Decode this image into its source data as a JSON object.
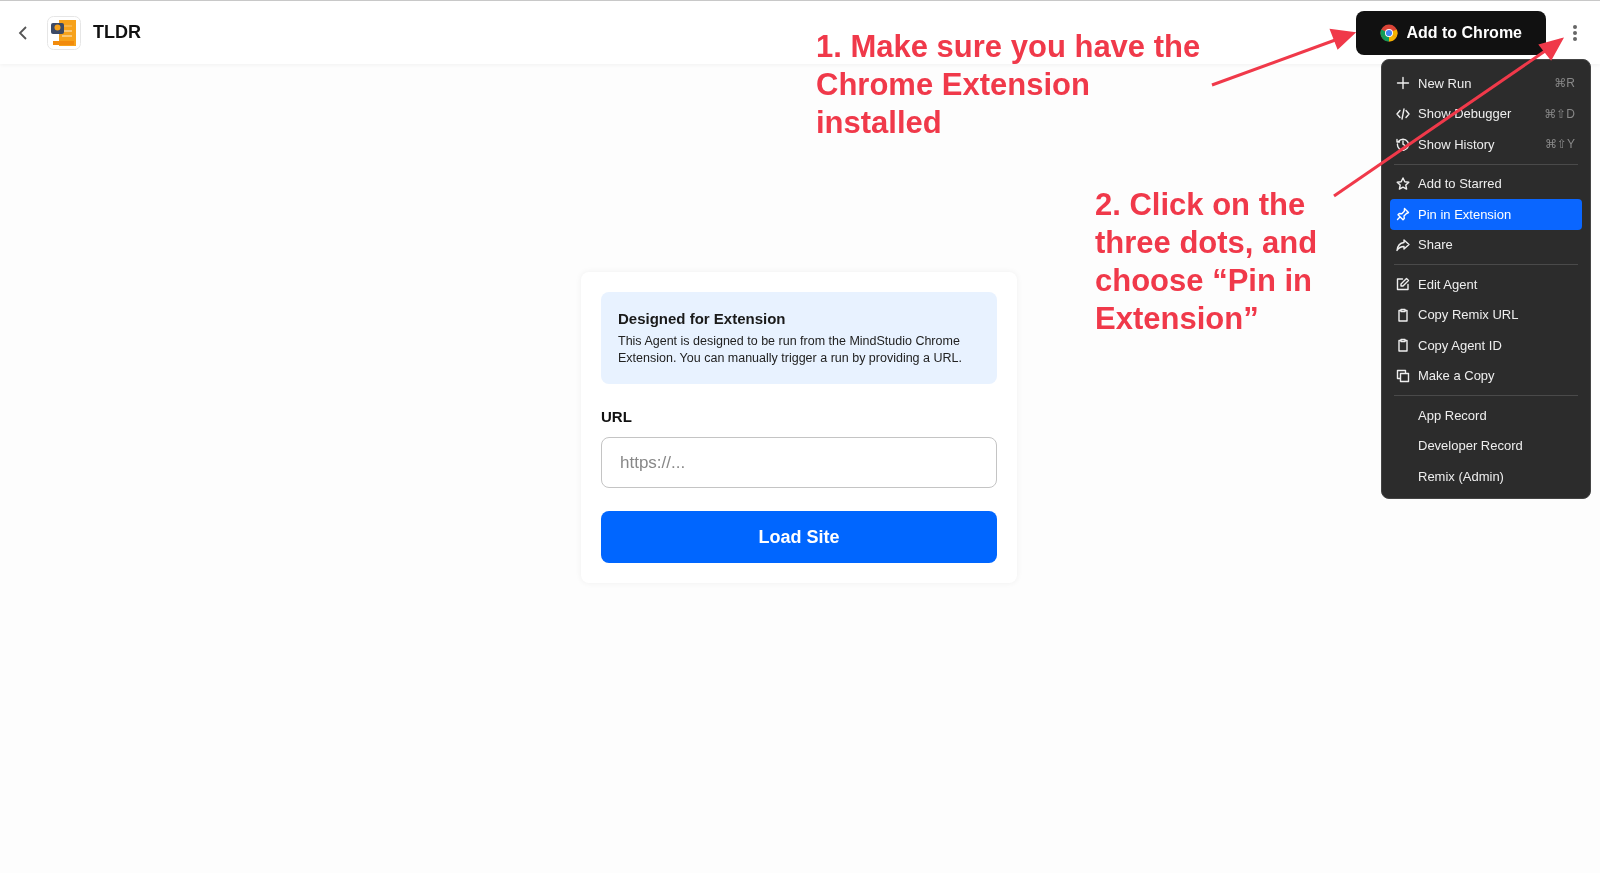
{
  "header": {
    "title": "TLDR",
    "add_button": "Add to Chrome"
  },
  "menu": {
    "groups": [
      [
        {
          "label": "New Run",
          "shortcut": "⌘R",
          "selected": false
        },
        {
          "label": "Show Debugger",
          "shortcut": "⌘⇧D",
          "selected": false
        },
        {
          "label": "Show History",
          "shortcut": "⌘⇧Y",
          "selected": false
        }
      ],
      [
        {
          "label": "Add to Starred",
          "selected": false
        },
        {
          "label": "Pin in Extension",
          "selected": true
        },
        {
          "label": "Share",
          "selected": false
        }
      ],
      [
        {
          "label": "Edit Agent",
          "selected": false
        },
        {
          "label": "Copy Remix URL",
          "selected": false
        },
        {
          "label": "Copy Agent ID",
          "selected": false
        },
        {
          "label": "Make a Copy",
          "selected": false
        }
      ],
      [
        {
          "label": "App Record",
          "selected": false
        },
        {
          "label": "Developer Record",
          "selected": false
        },
        {
          "label": "Remix (Admin)",
          "selected": false
        }
      ]
    ]
  },
  "card": {
    "notice_title": "Designed for Extension",
    "notice_text": "This Agent is designed to be run from the MindStudio Chrome Extension. You can manually trigger a run by providing a URL.",
    "field_label": "URL",
    "placeholder": "https://...",
    "submit": "Load Site"
  },
  "annotations": [
    "1. Make sure you have the Chrome Extension installed",
    "2. Click on the three dots, and choose “Pin in Extension”"
  ]
}
